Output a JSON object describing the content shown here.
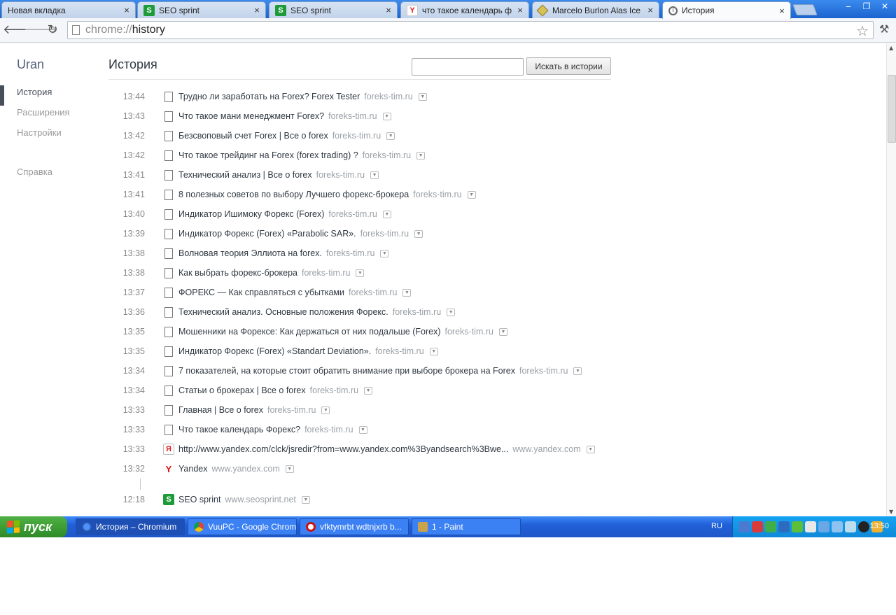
{
  "tabs": [
    {
      "title": "Новая вкладка",
      "icon": "none",
      "active": false
    },
    {
      "title": "SEO sprint",
      "icon": "seosprint-icon",
      "active": false
    },
    {
      "title": "SEO sprint",
      "icon": "seosprint-icon",
      "active": false
    },
    {
      "title": "что такое календарь фор",
      "icon": "yandex-icon",
      "active": false
    },
    {
      "title": "Marcelo Burlon Alas Ice ☐☐",
      "icon": "marcelo-burlon-icon",
      "active": false
    },
    {
      "title": "История",
      "icon": "history-clock-icon",
      "active": true
    }
  ],
  "toolbar": {
    "url_scheme": "chrome://",
    "url_host": "history"
  },
  "sidebar": {
    "title": "Uran",
    "items": [
      {
        "label": "История",
        "selected": true
      },
      {
        "label": "Расширения",
        "selected": false
      },
      {
        "label": "Настройки",
        "selected": false
      }
    ],
    "help": "Справка"
  },
  "main": {
    "title": "История",
    "search_button": "Искать в истории",
    "search_value": ""
  },
  "entries": [
    {
      "time": "13:44",
      "title": "Трудно ли заработать на Forex? Forex Tester",
      "domain": "foreks-tim.ru",
      "icon": "page"
    },
    {
      "time": "13:43",
      "title": "Что такое мани менеджмент Forex?",
      "domain": "foreks-tim.ru",
      "icon": "page"
    },
    {
      "time": "13:42",
      "title": "Безсвоповый счет Forex | Все о forex",
      "domain": "foreks-tim.ru",
      "icon": "page"
    },
    {
      "time": "13:42",
      "title": "Что такое трейдинг на Forex (forex trading) ?",
      "domain": "foreks-tim.ru",
      "icon": "page"
    },
    {
      "time": "13:41",
      "title": "Технический анализ | Все о forex",
      "domain": "foreks-tim.ru",
      "icon": "page"
    },
    {
      "time": "13:41",
      "title": "8 полезных советов по выбору Лучшего форекс-брокера",
      "domain": "foreks-tim.ru",
      "icon": "page"
    },
    {
      "time": "13:40",
      "title": "Индикатор Ишимоку Форекс (Forex)",
      "domain": "foreks-tim.ru",
      "icon": "page"
    },
    {
      "time": "13:39",
      "title": "Индикатор Форекс (Forex) «Parabolic SAR».",
      "domain": "foreks-tim.ru",
      "icon": "page"
    },
    {
      "time": "13:38",
      "title": "Волновая теория Эллиота на forex.",
      "domain": "foreks-tim.ru",
      "icon": "page"
    },
    {
      "time": "13:38",
      "title": "Как выбрать форекс-брокера",
      "domain": "foreks-tim.ru",
      "icon": "page"
    },
    {
      "time": "13:37",
      "title": "ФОРЕКС — Как справляться с убытками",
      "domain": "foreks-tim.ru",
      "icon": "page"
    },
    {
      "time": "13:36",
      "title": "Технический анализ. Основные положения Форекс.",
      "domain": "foreks-tim.ru",
      "icon": "page"
    },
    {
      "time": "13:35",
      "title": "Мошенники на Форексе: Как держаться от них подальше (Forex)",
      "domain": "foreks-tim.ru",
      "icon": "page"
    },
    {
      "time": "13:35",
      "title": "Индикатор Форекс (Forex) «Standart Deviation».",
      "domain": "foreks-tim.ru",
      "icon": "page"
    },
    {
      "time": "13:34",
      "title": "7 показателей, на которые стоит обратить внимание при выборе брокера на Forex",
      "domain": "foreks-tim.ru",
      "icon": "page"
    },
    {
      "time": "13:34",
      "title": "Статьи о брокерах | Все о forex",
      "domain": "foreks-tim.ru",
      "icon": "page"
    },
    {
      "time": "13:33",
      "title": "Главная | Все о forex",
      "domain": "foreks-tim.ru",
      "icon": "page"
    },
    {
      "time": "13:33",
      "title": "Что такое календарь Форекс?",
      "domain": "foreks-tim.ru",
      "icon": "page"
    },
    {
      "time": "13:33",
      "title": "http://www.yandex.com/clck/jsredir?from=www.yandex.com%3Byandsearch%3Bwe...",
      "domain": "www.yandex.com",
      "icon": "yandex-ya"
    },
    {
      "time": "13:32",
      "title": "Yandex",
      "domain": "www.yandex.com",
      "icon": "yandex-y"
    }
  ],
  "entries_after_gap": [
    {
      "time": "12:18",
      "title": "SEO sprint",
      "domain": "www.seosprint.net",
      "icon": "seo"
    }
  ],
  "taskbar": {
    "start_label": "пуск",
    "tasks": [
      {
        "label": "История – Chromium",
        "active": true
      },
      {
        "label": "VuuPC - Google Chrome",
        "active": false
      },
      {
        "label": "vfktymrbt wdtnjxrb b...",
        "active": false
      },
      {
        "label": "1 - Paint",
        "active": false
      }
    ],
    "language": "RU",
    "clock": "13:50"
  },
  "colors": {
    "tab_strip": "#2a73e0",
    "taskbar": "#2160d8",
    "start_green": "#3a9a30",
    "domain_text": "#9aa0a6"
  }
}
